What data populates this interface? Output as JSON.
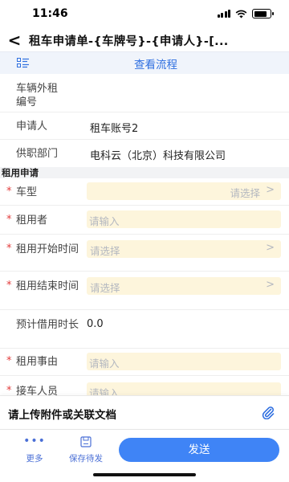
{
  "status_bar": {
    "time": "11:46"
  },
  "header": {
    "title": "租车申请单-{车牌号}-{申请人}-[..."
  },
  "toolbar": {
    "view_flow": "查看流程"
  },
  "info_rows": {
    "external_id_label": "车辆外租编号",
    "external_id_value": "",
    "applicant_label": "申请人",
    "applicant_value": "租车账号2",
    "department_label": "供职部门",
    "department_value": "电科云（北京）科技有限公司"
  },
  "section": {
    "title": "租用申请"
  },
  "form": {
    "car_type": {
      "label": "车型",
      "placeholder": "请选择"
    },
    "renter": {
      "label": "租用者",
      "placeholder": "请输入"
    },
    "start_time": {
      "label": "租用开始时间",
      "placeholder": "请选择"
    },
    "end_time": {
      "label": "租用结束时间",
      "placeholder": "请选择"
    },
    "duration": {
      "label": "预计借用时长",
      "value": "0.0"
    },
    "reason": {
      "label": "租用事由",
      "placeholder": "请输入"
    },
    "pickup": {
      "label": "接车人员",
      "placeholder": "请输入"
    }
  },
  "attachment": {
    "text": "请上传附件或关联文档"
  },
  "actions": {
    "more": "更多",
    "save_draft": "保存待发",
    "send": "发送"
  },
  "colors": {
    "primary": "#3f84f6",
    "link": "#2f6fe0",
    "required": "#e23c3c",
    "field_bg": "#fdf5dc"
  }
}
